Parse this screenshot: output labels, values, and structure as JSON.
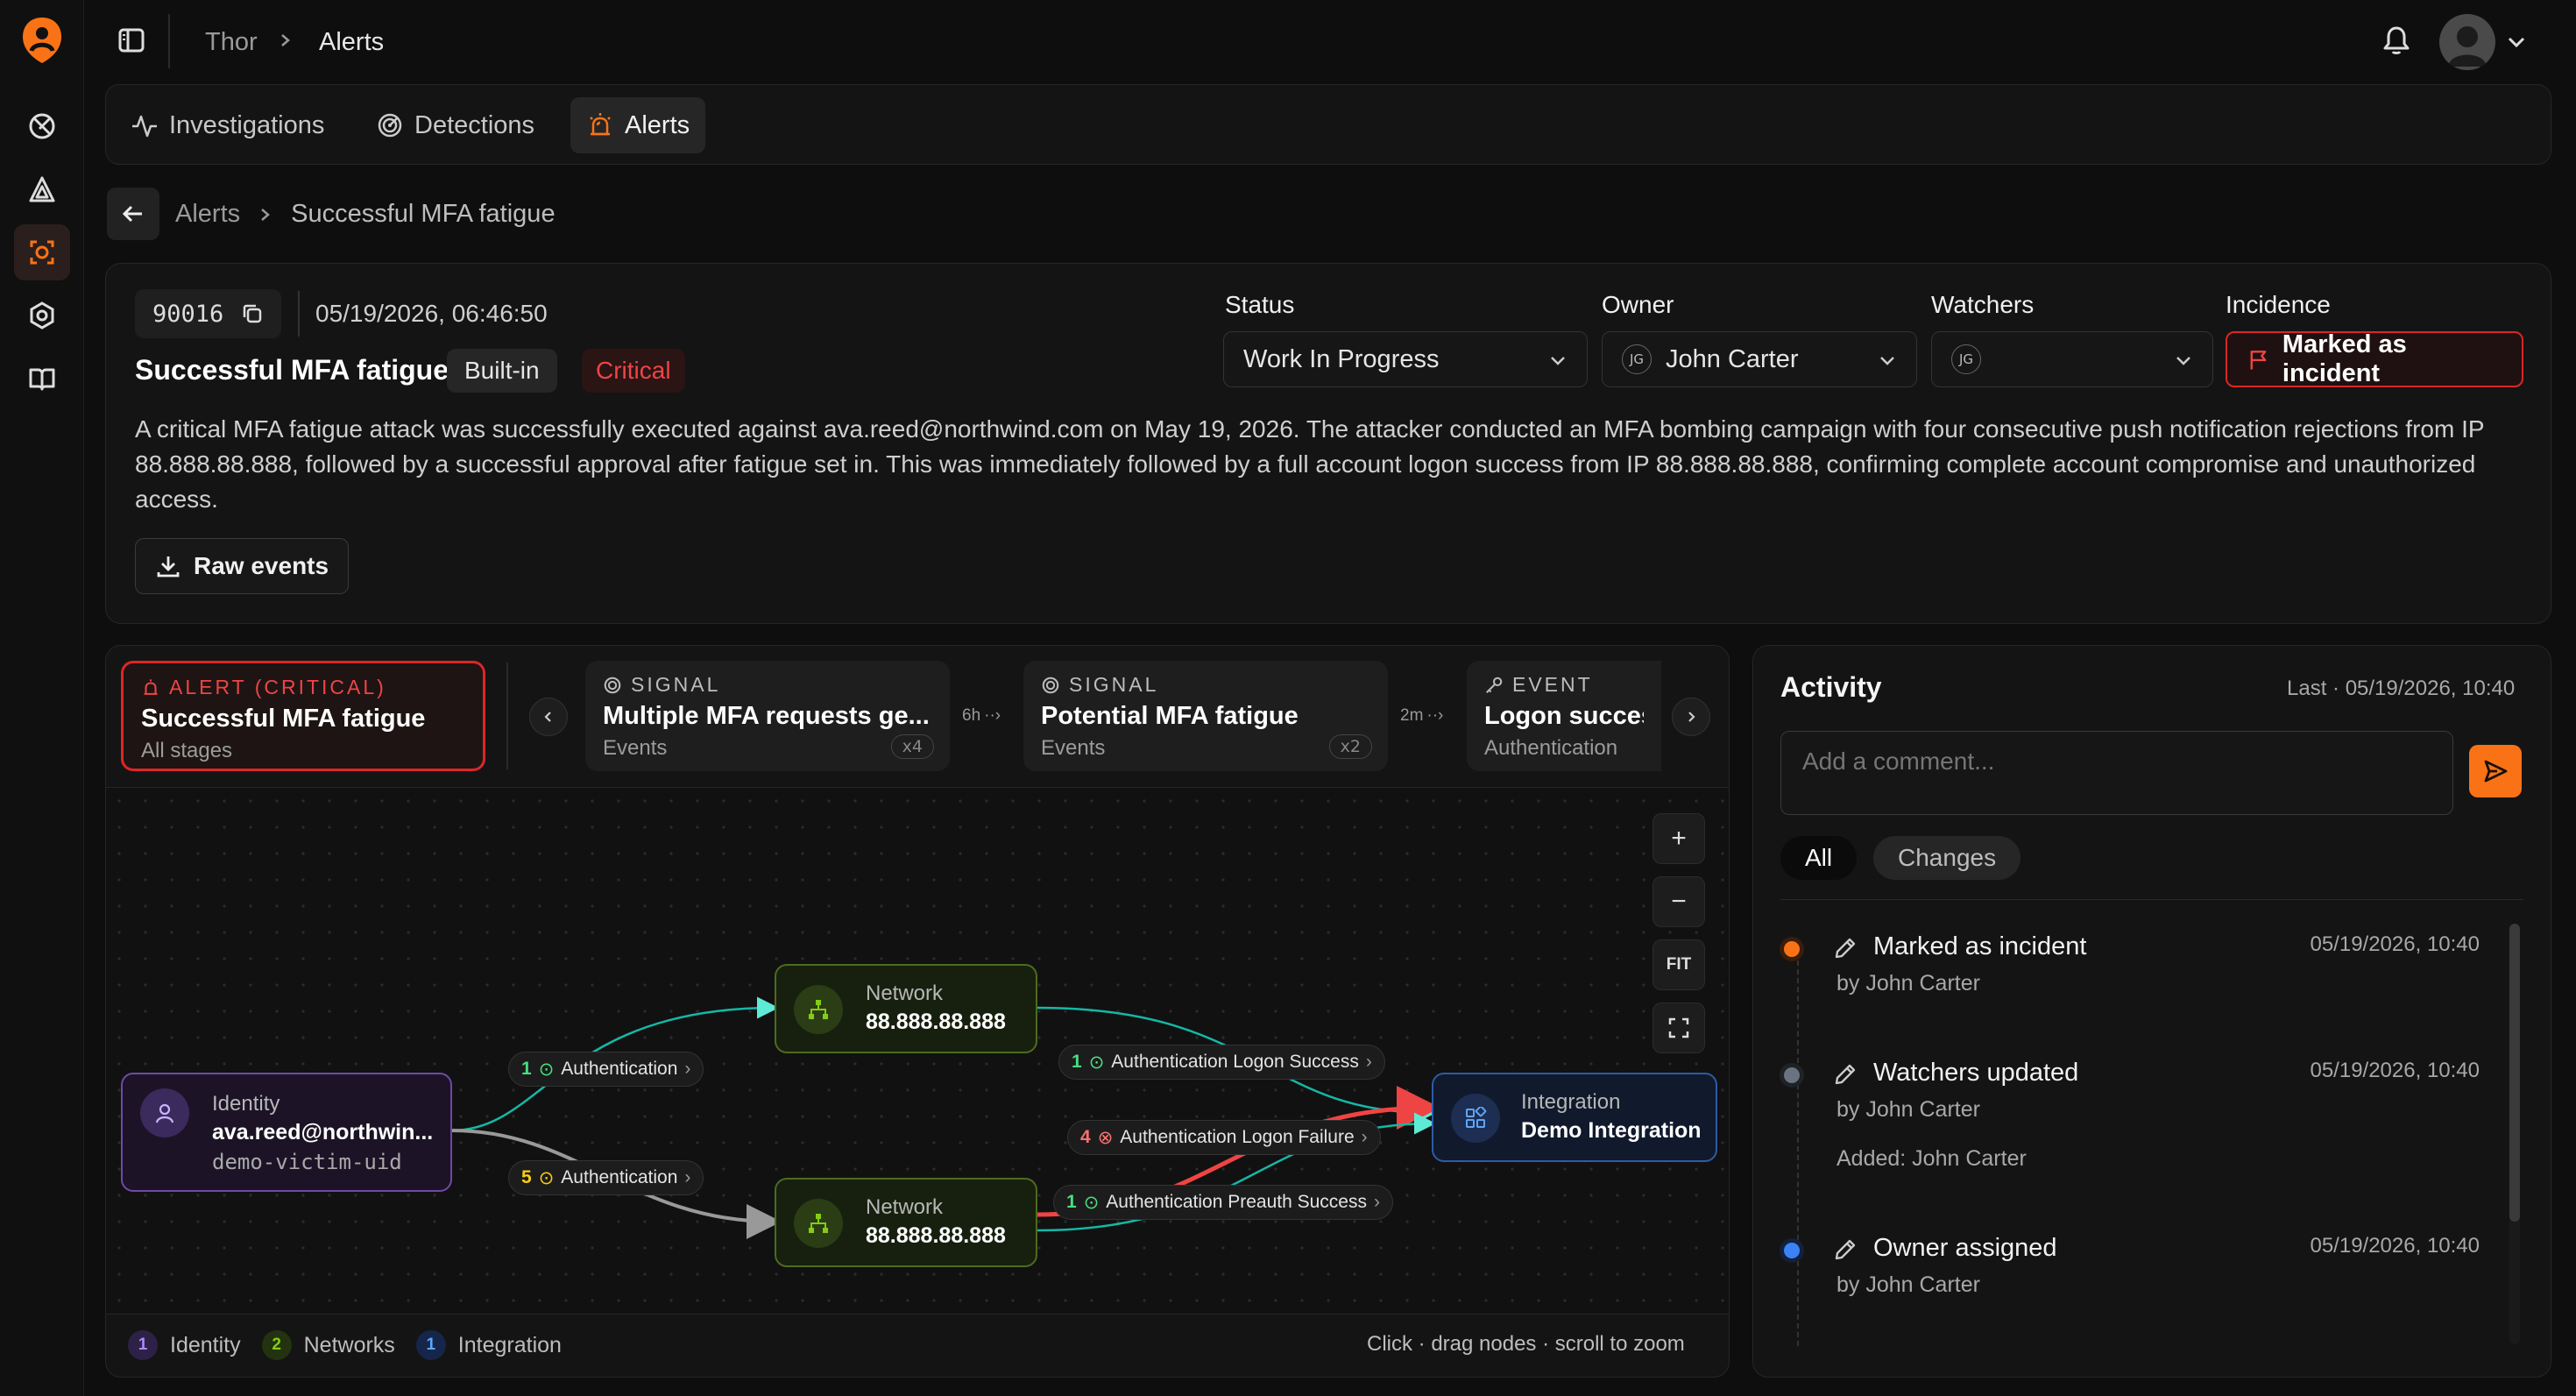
{
  "app": {
    "workspace": "Thor",
    "section": "Alerts"
  },
  "tabs": [
    {
      "label": "Investigations",
      "icon": "activity-icon"
    },
    {
      "label": "Detections",
      "icon": "radar-icon"
    },
    {
      "label": "Alerts",
      "icon": "siren-icon"
    }
  ],
  "breadcrumb": {
    "parent": "Alerts",
    "current": "Successful MFA fatigue"
  },
  "alert": {
    "id": "90016",
    "timestamp": "05/19/2026, 06:46:50",
    "title": "Successful MFA fatigue",
    "type_badge": "Built-in",
    "severity": "Critical",
    "description": "A critical MFA fatigue attack was successfully executed against ava.reed@northwind.com on May 19, 2026. The attacker conducted an MFA bombing campaign with four consecutive push notification rejections from IP 88.888.88.888, followed by a successful approval after fatigue set in. This was immediately followed by a full account logon success from IP 88.888.88.888, confirming complete account compromise and unauthorized access.",
    "raw_events_label": "Raw events"
  },
  "fields": {
    "status": {
      "label": "Status",
      "value": "Work In Progress"
    },
    "owner": {
      "label": "Owner",
      "initials": "JG",
      "value": "John Carter"
    },
    "watchers": {
      "label": "Watchers",
      "initials": "JG"
    },
    "incidence": {
      "label": "Incidence",
      "value": "Marked as incident"
    }
  },
  "stages": [
    {
      "kind": "ALERT (CRITICAL)",
      "title": "Successful MFA fatigue",
      "sub": "All stages"
    },
    {
      "kind": "SIGNAL",
      "title": "Multiple MFA requests ge...",
      "sub": "Events",
      "badge": "x4"
    },
    {
      "kind": "SIGNAL",
      "title": "Potential MFA fatigue",
      "sub": "Events",
      "badge": "x2"
    },
    {
      "kind": "EVENT",
      "title": "Logon success",
      "sub": "Authentication"
    }
  ],
  "stage_gaps": [
    "6h",
    "2m"
  ],
  "graph": {
    "identity": {
      "type": "Identity",
      "value": "ava.reed@northwin...",
      "sub": "demo-victim-uid"
    },
    "network_top": {
      "type": "Network",
      "value": "88.888.88.888"
    },
    "network_bottom": {
      "type": "Network",
      "value": "88.888.88.888"
    },
    "integration": {
      "type": "Integration",
      "value": "Demo Integration"
    },
    "edges": [
      {
        "count": "1",
        "label": "Authentication"
      },
      {
        "count": "5",
        "label": "Authentication"
      },
      {
        "count": "1",
        "label": "Authentication Logon Success"
      },
      {
        "count": "4",
        "label": "Authentication Logon Failure"
      },
      {
        "count": "1",
        "label": "Authentication Preauth Success"
      }
    ],
    "zoom": {
      "fit": "FIT"
    },
    "legend": [
      {
        "count": "1",
        "label": "Identity",
        "color": "#8b5cf6"
      },
      {
        "count": "2",
        "label": "Networks",
        "color": "#84cc16"
      },
      {
        "count": "1",
        "label": "Integration",
        "color": "#3b82f6"
      }
    ],
    "hint": "Click · drag nodes · scroll to zoom"
  },
  "activity": {
    "title": "Activity",
    "last": "Last · 05/19/2026, 10:40",
    "comment_placeholder": "Add a comment...",
    "filters": [
      "All",
      "Changes"
    ],
    "items": [
      {
        "title": "Marked as incident",
        "time": "05/19/2026, 10:40",
        "by": "by John Carter",
        "dot": "#f97316"
      },
      {
        "title": "Watchers updated",
        "time": "05/19/2026, 10:40",
        "by": "by John Carter",
        "extra": "Added: John Carter",
        "dot": "#6b7280"
      },
      {
        "title": "Owner assigned",
        "time": "05/19/2026, 10:40",
        "by": "by John Carter",
        "dot": "#3b82f6"
      }
    ]
  },
  "colors": {
    "accent": "#f97316",
    "critical": "#ef4444",
    "network": "#84cc16",
    "identity": "#8b5cf6",
    "integration": "#3b82f6"
  }
}
